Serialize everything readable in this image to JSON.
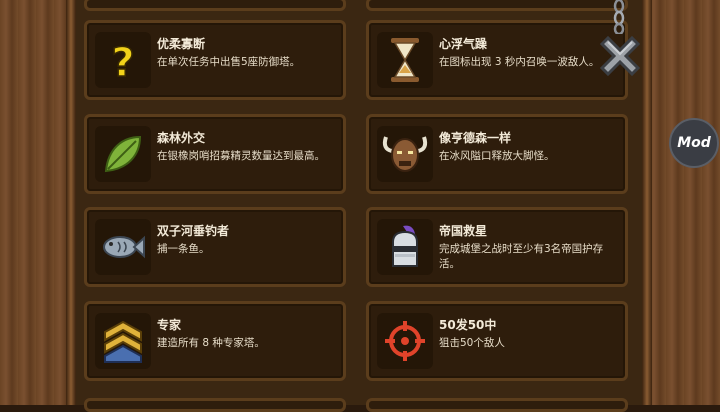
{
  "achievements": [
    {
      "title": "优柔寡断",
      "desc": "在单次任务中出售5座防御塔。",
      "icon": "question-mark-icon"
    },
    {
      "title": "心浮气躁",
      "desc": "在图标出现 3 秒内召唤一波敌人。",
      "icon": "hourglass-icon"
    },
    {
      "title": "森林外交",
      "desc": "在银橡岗哨招募精灵数量达到最高。",
      "icon": "leaf-icon"
    },
    {
      "title": "像亨德森一样",
      "desc": "在冰风隘口释放大脚怪。",
      "icon": "viking-beast-icon"
    },
    {
      "title": "双子河垂钓者",
      "desc": "捕一条鱼。",
      "icon": "fish-icon"
    },
    {
      "title": "帝国救星",
      "desc": "完成城堡之战时至少有3名帝国护存活。",
      "icon": "knight-helmet-icon"
    },
    {
      "title": "专家",
      "desc": "建造所有 8 种专家塔。",
      "icon": "chevron-rank-icon"
    },
    {
      "title": "50发50中",
      "desc": "狙击50个敌人",
      "icon": "crosshair-icon"
    }
  ],
  "mod_button": {
    "label": "Mod"
  },
  "colors": {
    "card_bg": "#2e1d0c",
    "card_border": "#5b3d1c",
    "title": "#f3ead8",
    "panel": "#3b2712"
  }
}
